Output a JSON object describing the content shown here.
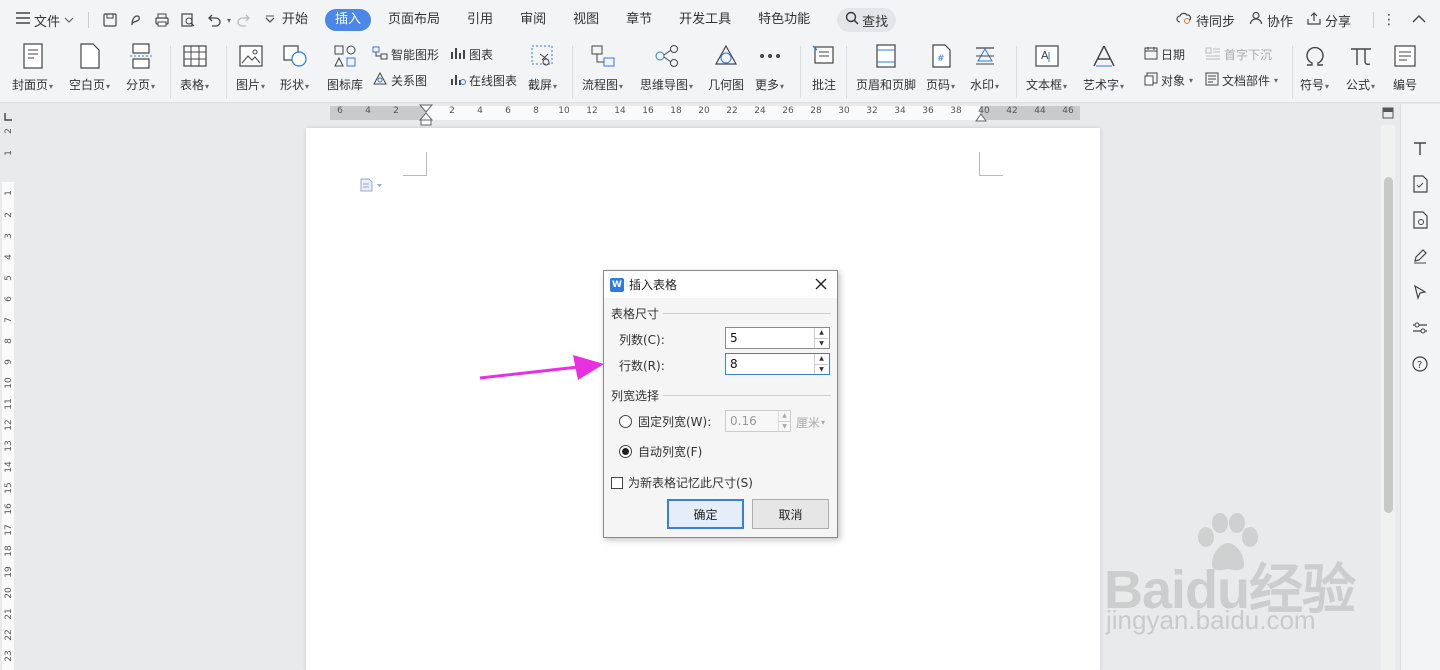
{
  "menubar": {
    "file_label": "文件",
    "tabs": [
      {
        "label": "开始"
      },
      {
        "label": "插入",
        "active": true
      },
      {
        "label": "页面布局"
      },
      {
        "label": "引用"
      },
      {
        "label": "审阅"
      },
      {
        "label": "视图"
      },
      {
        "label": "章节"
      },
      {
        "label": "开发工具"
      },
      {
        "label": "特色功能"
      }
    ],
    "search_label": "查找",
    "sync_label": "待同步",
    "collab_label": "协作",
    "share_label": "分享"
  },
  "ribbon": {
    "cover_page": "封面页",
    "blank_page": "空白页",
    "page_break": "分页",
    "table": "表格",
    "picture": "图片",
    "shape": "形状",
    "icon_library": "图标库",
    "smart_art": "智能图形",
    "chart": "图表",
    "relation_chart": "关系图",
    "online_chart": "在线图表",
    "screenshot": "截屏",
    "flowchart": "流程图",
    "mind_map": "思维导图",
    "geometry": "几何图",
    "more": "更多",
    "comment": "批注",
    "header_footer": "页眉和页脚",
    "page_number": "页码",
    "watermark": "水印",
    "text_box": "文本框",
    "word_art": "艺术字",
    "date": "日期",
    "object": "对象",
    "drop_cap": "首字下沉",
    "doc_parts": "文档部件",
    "symbol": "符号",
    "formula": "公式",
    "numbering": "编号"
  },
  "ruler": {
    "h_numbers": [
      "6",
      "4",
      "2",
      "2",
      "4",
      "6",
      "8",
      "10",
      "12",
      "14",
      "16",
      "18",
      "20",
      "22",
      "24",
      "26",
      "28",
      "30",
      "32",
      "34",
      "36",
      "38",
      "40",
      "42",
      "44",
      "46"
    ],
    "v_numbers": [
      "2",
      "1",
      "1",
      "2",
      "3",
      "4",
      "5",
      "6",
      "7",
      "8",
      "9",
      "10",
      "11",
      "12",
      "13",
      "14",
      "15",
      "16",
      "17",
      "18",
      "19",
      "20",
      "21",
      "22",
      "23"
    ]
  },
  "dialog": {
    "title": "插入表格",
    "size_group": "表格尺寸",
    "columns_label": "列数(C):",
    "columns_value": "5",
    "rows_label": "行数(R):",
    "rows_value": "8",
    "width_group": "列宽选择",
    "fixed_width_label": "固定列宽(W):",
    "fixed_width_value": "0.16",
    "unit": "厘米",
    "auto_width_label": "自动列宽(F)",
    "remember_label": "为新表格记忆此尺寸(S)",
    "ok_label": "确定",
    "cancel_label": "取消"
  },
  "watermark": {
    "brand": "Baidu经验",
    "url": "jingyan.baidu.com"
  },
  "colors": {
    "accent": "#4a87e8",
    "arrow": "#e830e0",
    "dialog_focus": "#3b7fd6"
  }
}
